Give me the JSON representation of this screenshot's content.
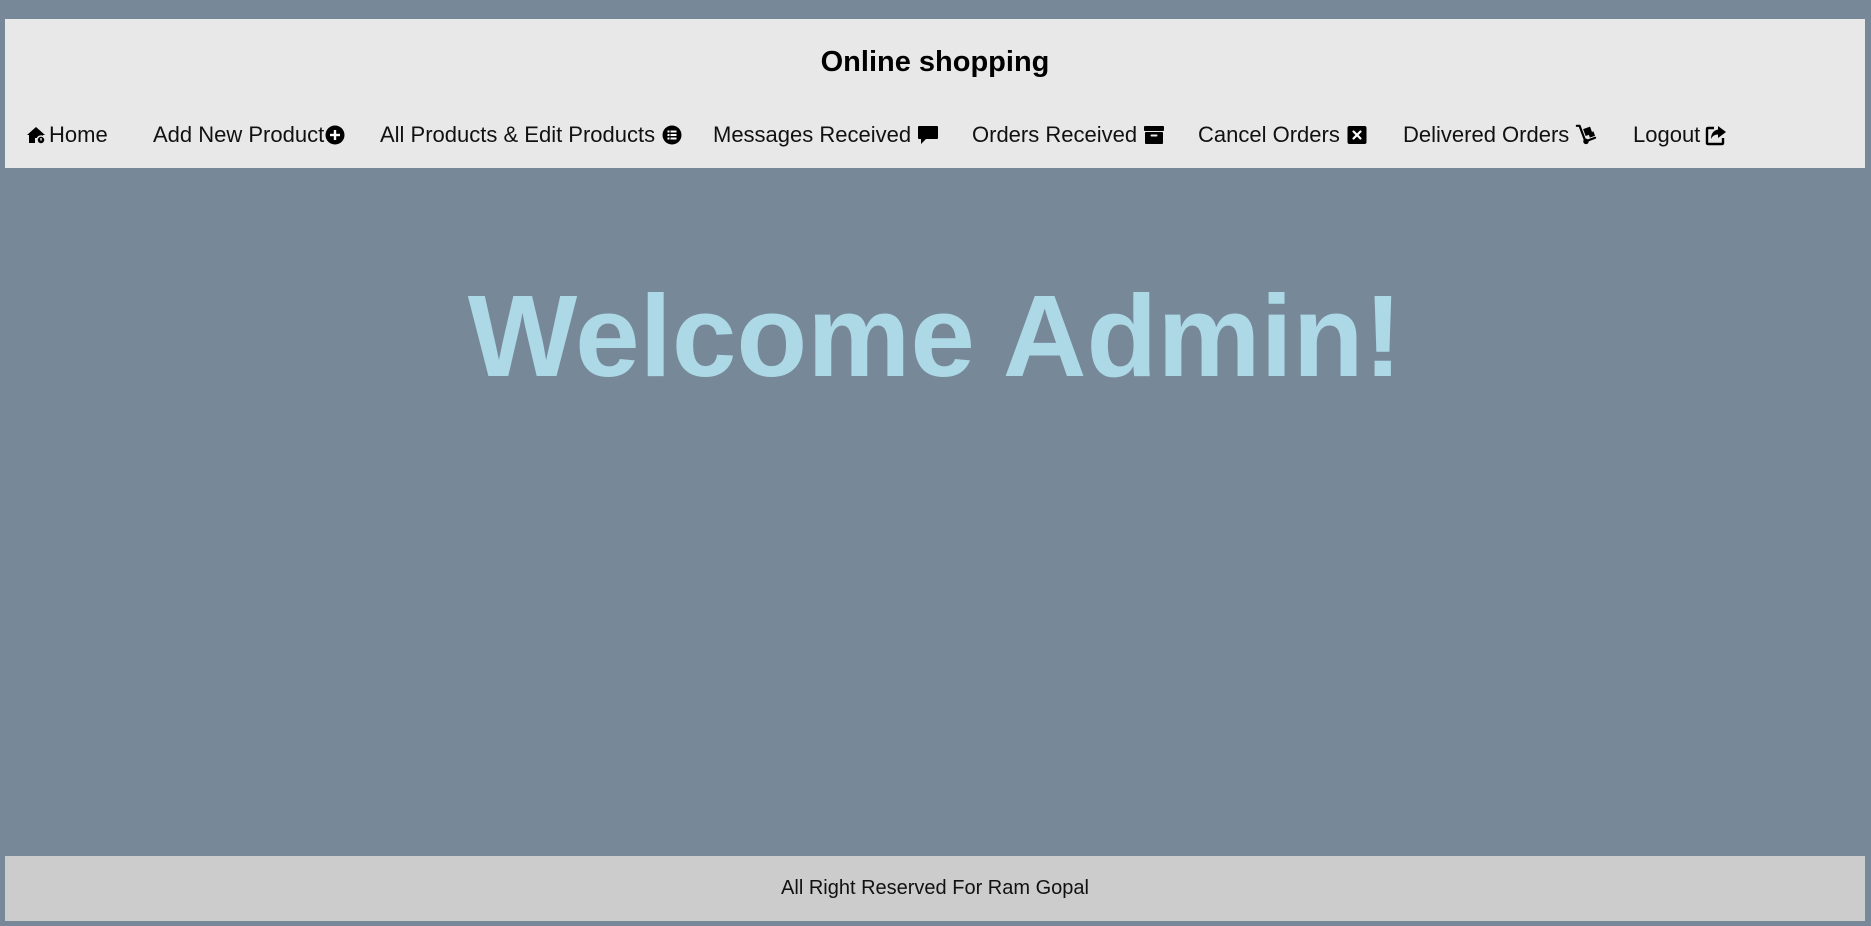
{
  "header": {
    "title": "Online shopping"
  },
  "nav": {
    "items": [
      {
        "label": "Home",
        "icon": "home-icon"
      },
      {
        "label": "Add New Product",
        "icon": "plus-circle-icon"
      },
      {
        "label": "All Products & Edit Products",
        "icon": "list-circle-icon"
      },
      {
        "label": "Messages Received",
        "icon": "message-icon"
      },
      {
        "label": "Orders Received",
        "icon": "archive-box-icon"
      },
      {
        "label": "Cancel Orders",
        "icon": "close-square-icon"
      },
      {
        "label": "Delivered Orders",
        "icon": "dolly-icon"
      },
      {
        "label": "Logout",
        "icon": "share-out-icon"
      }
    ]
  },
  "main": {
    "welcome": "Welcome Admin!"
  },
  "footer": {
    "text": "All Right Reserved For Ram Gopal"
  },
  "colors": {
    "background": "#778899",
    "header": "#e8e8e8",
    "footer": "#cccccc",
    "welcome": "#add8e6"
  }
}
